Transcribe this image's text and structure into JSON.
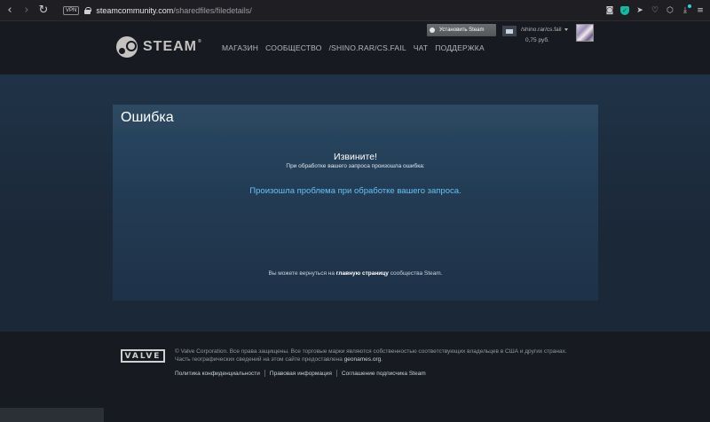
{
  "browser": {
    "vpn_label": "VPN",
    "url_domain": "steamcommunity.com",
    "url_path": "/sharedfiles/filedetails/",
    "icons": [
      "back-icon",
      "forward-icon",
      "reload-icon",
      "camera-icon",
      "shield-icon",
      "send-icon",
      "heart-icon",
      "cube-icon",
      "download-icon",
      "menu-icon"
    ]
  },
  "header": {
    "logo_text": "STEAM",
    "logo_mark": "®",
    "nav": [
      "МАГАЗИН",
      "СООБЩЕСТВО",
      "/SHINO.RAR/CS.FAIL",
      "ЧАТ",
      "ПОДДЕРЖКА"
    ],
    "install_label": "Установить Steam",
    "account_name": "/shino.rar/cs.fail",
    "wallet": "0,75 руб."
  },
  "error": {
    "title": "Ошибка",
    "sorry": "Извините!",
    "sorry_sub": "При обработке вашего запроса произошла ошибка:",
    "problem": "Произошла проблема при обработке вашего запроса.",
    "return_prefix": "Вы можете вернуться на",
    "return_link": "главную страницу",
    "return_suffix": "сообщества Steam."
  },
  "footer": {
    "valve_logo": "VALVE",
    "copyright_line1": "© Valve Corporation. Все права защищены. Все торговые марки являются собственностью соответствующих владельцев в США и других странах.",
    "copyright_line2": "Часть географических сведений на этом сайте предоставлена",
    "geonames": "geonames.org",
    "links": [
      "Политика конфиденциальности",
      "Правовая информация",
      "Соглашение подписчика Steam"
    ]
  },
  "colors": {
    "page_bg": "#1b2838",
    "header_bg": "#171a21",
    "link_blue": "#66c0f4"
  }
}
